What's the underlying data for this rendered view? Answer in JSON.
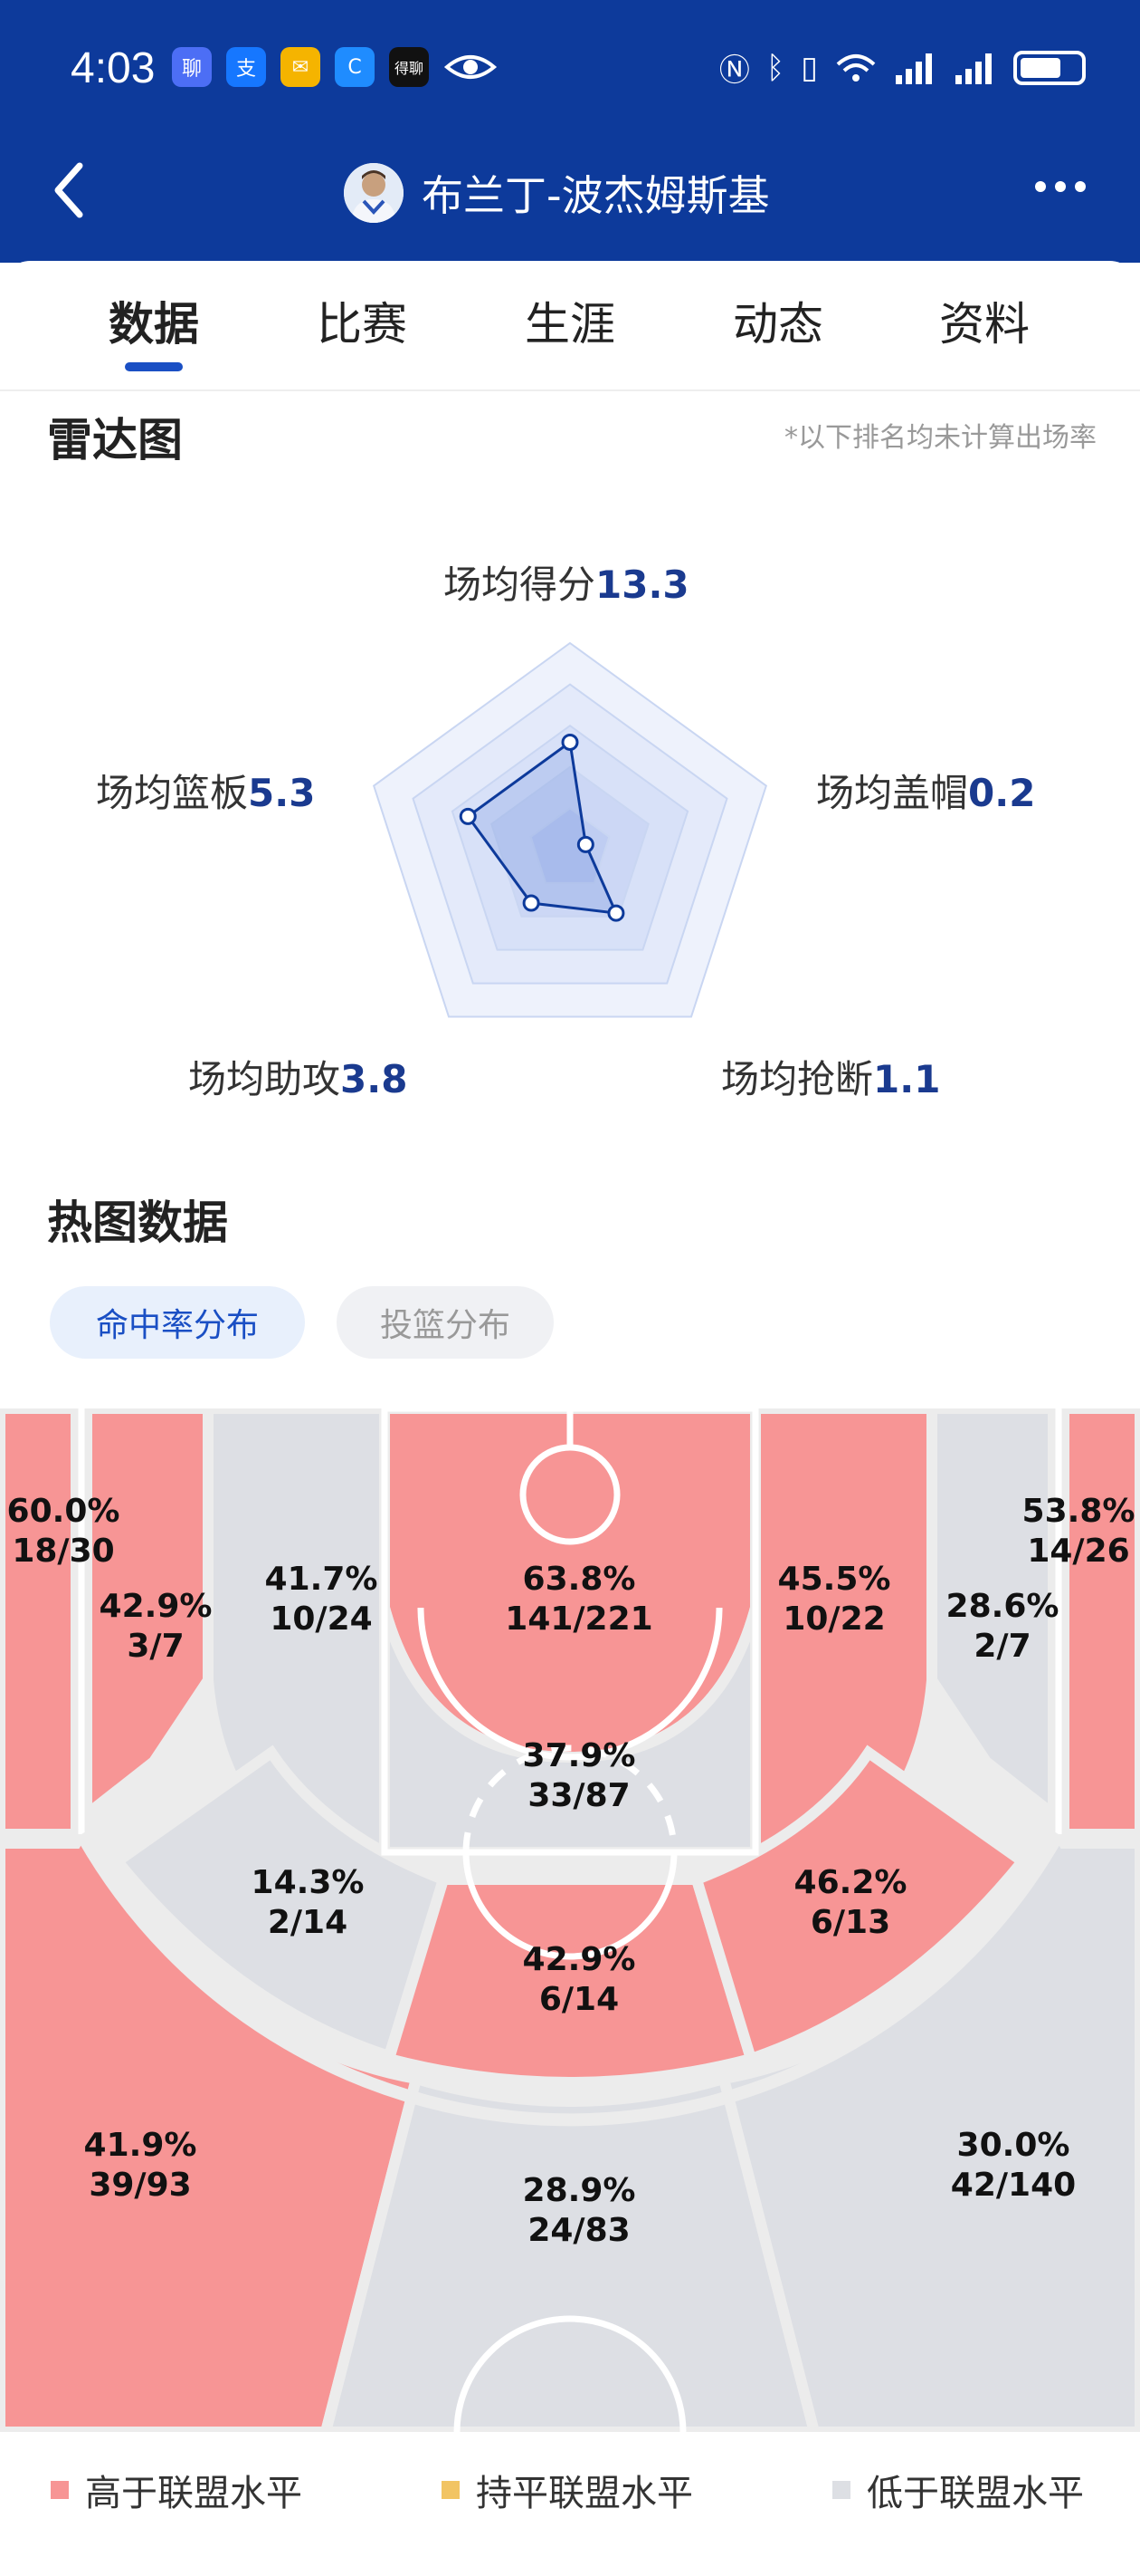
{
  "status_bar": {
    "time": "4:03",
    "apps": [
      "聊",
      "支",
      "✉",
      "C",
      "得聊"
    ]
  },
  "header": {
    "title": "布兰丁-波杰姆斯基"
  },
  "tabs": [
    {
      "label": "数据",
      "active": true
    },
    {
      "label": "比赛",
      "active": false
    },
    {
      "label": "生涯",
      "active": false
    },
    {
      "label": "动态",
      "active": false
    },
    {
      "label": "资料",
      "active": false
    }
  ],
  "radar": {
    "title": "雷达图",
    "note": "*以下排名均未计算出场率",
    "metrics": [
      {
        "label": "场均得分",
        "value": "13.3",
        "level": 0.52
      },
      {
        "label": "场均盖帽",
        "value": "0.2",
        "level": 0.08
      },
      {
        "label": "场均抢断",
        "value": "1.1",
        "level": 0.38
      },
      {
        "label": "场均助攻",
        "value": "3.8",
        "level": 0.32
      },
      {
        "label": "场均篮板",
        "value": "5.3",
        "level": 0.52
      }
    ]
  },
  "heatmap": {
    "title": "热图数据",
    "modes": [
      "命中率分布",
      "投篮分布"
    ],
    "colors": {
      "above": "#f79595",
      "equal": "#f2c463",
      "below": "#dddfe4"
    },
    "zones": [
      {
        "id": "left-corner-3",
        "pct": "60.0%",
        "made": "18/30",
        "level": "above"
      },
      {
        "id": "left-baseline-mid",
        "pct": "42.9%",
        "made": "3/7",
        "level": "above"
      },
      {
        "id": "left-short-mid",
        "pct": "41.7%",
        "made": "10/24",
        "level": "below"
      },
      {
        "id": "restricted-area",
        "pct": "63.8%",
        "made": "141/221",
        "level": "above"
      },
      {
        "id": "right-short-mid",
        "pct": "45.5%",
        "made": "10/22",
        "level": "above"
      },
      {
        "id": "right-baseline-mid",
        "pct": "28.6%",
        "made": "2/7",
        "level": "below"
      },
      {
        "id": "right-corner-3",
        "pct": "53.8%",
        "made": "14/26",
        "level": "above"
      },
      {
        "id": "paint",
        "pct": "37.9%",
        "made": "33/87",
        "level": "below"
      },
      {
        "id": "left-elbow-mid",
        "pct": "14.3%",
        "made": "2/14",
        "level": "below"
      },
      {
        "id": "top-key-mid",
        "pct": "42.9%",
        "made": "6/14",
        "level": "above"
      },
      {
        "id": "right-elbow-mid",
        "pct": "46.2%",
        "made": "6/13",
        "level": "above"
      },
      {
        "id": "left-wing-3",
        "pct": "41.9%",
        "made": "39/93",
        "level": "above"
      },
      {
        "id": "top-3",
        "pct": "28.9%",
        "made": "24/83",
        "level": "below"
      },
      {
        "id": "right-wing-3",
        "pct": "30.0%",
        "made": "42/140",
        "level": "below"
      }
    ]
  },
  "legend": [
    {
      "label": "高于联盟水平",
      "color": "#f79595"
    },
    {
      "label": "持平联盟水平",
      "color": "#f2c463"
    },
    {
      "label": "低于联盟水平",
      "color": "#dddfe4"
    }
  ]
}
